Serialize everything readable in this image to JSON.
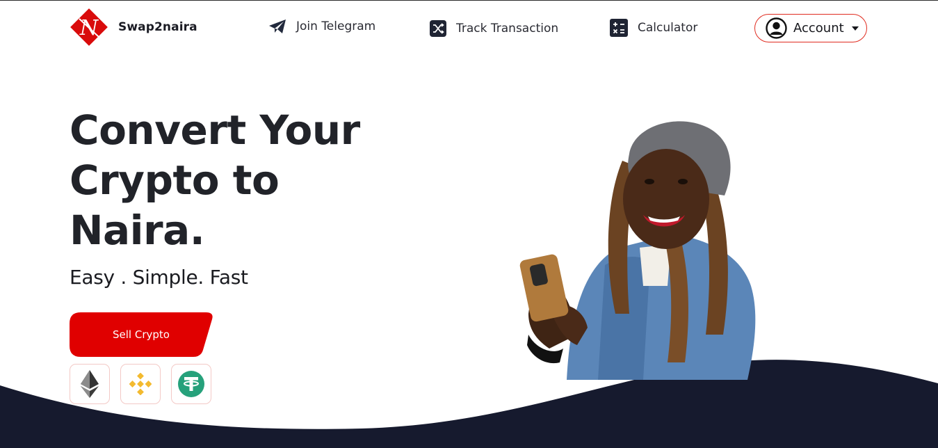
{
  "brand": {
    "name": "Swap2naira",
    "logo_letter": "N",
    "color": "#e00000"
  },
  "nav": {
    "items": [
      {
        "label": "Join Telegram",
        "icon": "telegram-icon"
      },
      {
        "label": "Track Transaction",
        "icon": "shuffle-icon"
      },
      {
        "label": "Calculator",
        "icon": "calculator-icon"
      }
    ],
    "account": {
      "label": "Account",
      "icon": "user-circle-icon",
      "dropdown": "caret-down-icon"
    }
  },
  "hero": {
    "title": "Convert Your Crypto to Naira.",
    "tagline": "Easy . Simple. Fast",
    "cta_label": "Sell Crypto",
    "coins": [
      "ethereum-icon",
      "binance-icon",
      "tether-icon"
    ]
  },
  "colors": {
    "accent": "#e00000",
    "dark": "#161a2e",
    "text": "#212329"
  }
}
